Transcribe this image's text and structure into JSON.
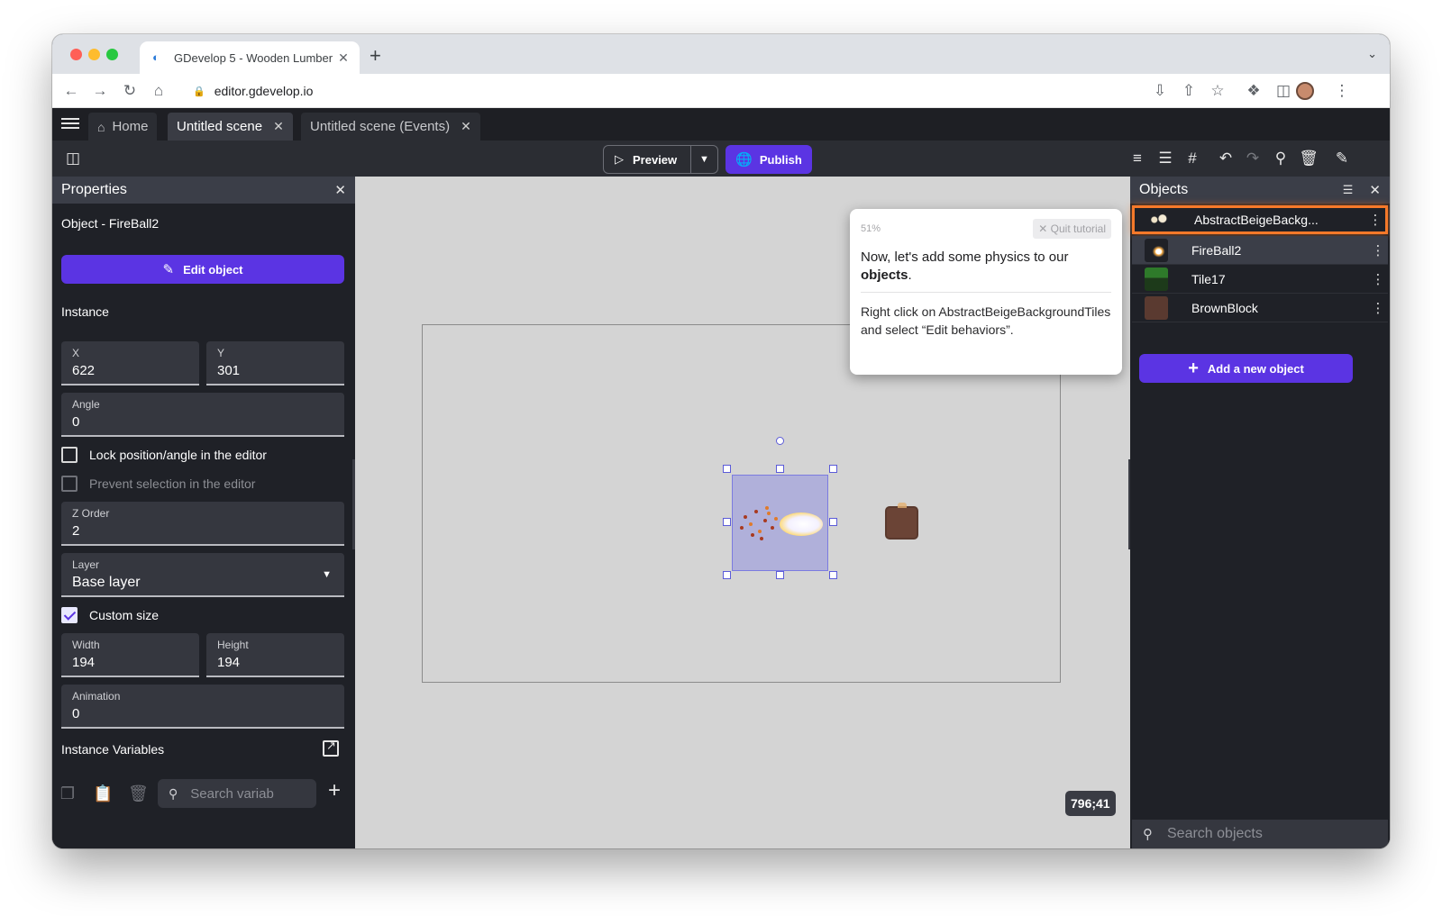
{
  "browser": {
    "tab_title": "GDevelop 5 - Wooden Lumber",
    "tab_close": "✕",
    "new_tab": "+",
    "url": "editor.gdevelop.io"
  },
  "app_tabs": [
    {
      "label": "Home",
      "icon": "home-icon"
    },
    {
      "label": "Untitled scene",
      "active": true,
      "close": "✕"
    },
    {
      "label": "Untitled scene (Events)",
      "close": "✕"
    }
  ],
  "toolbar": {
    "preview_label": "Preview",
    "publish_label": "Publish"
  },
  "properties": {
    "title": "Properties",
    "object_line": "Object  - FireBall2",
    "edit_object_label": "Edit object",
    "instance_label": "Instance",
    "x": {
      "label": "X",
      "value": "622"
    },
    "y": {
      "label": "Y",
      "value": "301"
    },
    "angle": {
      "label": "Angle",
      "value": "0"
    },
    "lock_label": "Lock position/angle in the editor",
    "prevent_label": "Prevent selection in the editor",
    "z_order": {
      "label": "Z Order",
      "value": "2"
    },
    "layer": {
      "label": "Layer",
      "value": "Base layer"
    },
    "custom_size_label": "Custom size",
    "custom_size_checked": true,
    "width": {
      "label": "Width",
      "value": "194"
    },
    "height": {
      "label": "Height",
      "value": "194"
    },
    "animation": {
      "label": "Animation",
      "value": "0"
    },
    "instance_variables_label": "Instance Variables",
    "search_placeholder": "Search variab"
  },
  "canvas": {
    "coords": "796;41"
  },
  "tutorial": {
    "progress": "51%",
    "quit_label": "Quit tutorial",
    "headline_prefix": "Now, let's add some physics to our ",
    "headline_bold": "objects",
    "headline_suffix": ".",
    "body": "Right click on AbstractBeigeBackgroundTiles and select “Edit behaviors”."
  },
  "objects": {
    "title": "Objects",
    "items": [
      {
        "name": "AbstractBeigeBackg...",
        "thumb": "abstract"
      },
      {
        "name": "FireBall2",
        "thumb": "fire"
      },
      {
        "name": "Tile17",
        "thumb": "tile"
      },
      {
        "name": "BrownBlock",
        "thumb": "brown"
      }
    ],
    "add_label": "Add a new object",
    "search_placeholder": "Search objects"
  },
  "colors": {
    "accent": "#5b34e3",
    "highlight": "#f5792a"
  }
}
